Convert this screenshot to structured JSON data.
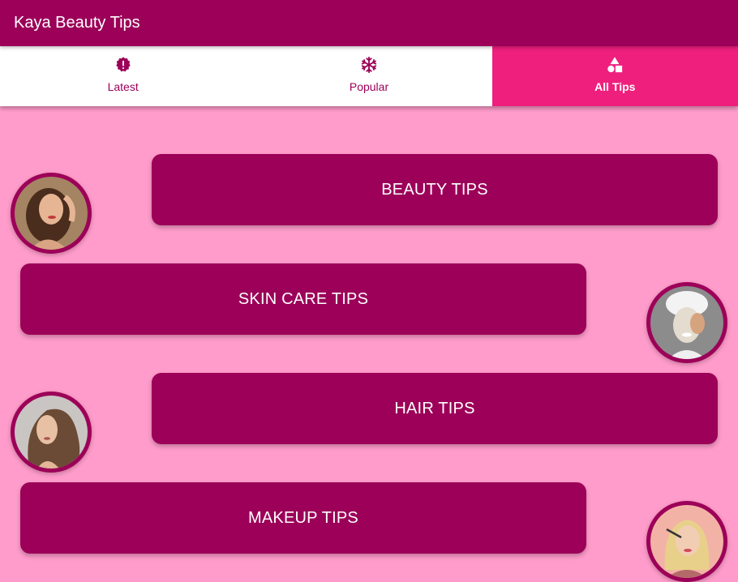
{
  "app": {
    "title": "Kaya Beauty Tips"
  },
  "tabs": [
    {
      "label": "Latest",
      "icon": "alert-badge-icon",
      "active": false
    },
    {
      "label": "Popular",
      "icon": "snowflake-icon",
      "active": false
    },
    {
      "label": "All Tips",
      "icon": "shapes-icon",
      "active": true
    }
  ],
  "categories": [
    {
      "label": "BEAUTY TIPS",
      "avatar": "woman-portrait-wavy-hair"
    },
    {
      "label": "SKIN CARE TIPS",
      "avatar": "woman-face-mask"
    },
    {
      "label": "HAIR TIPS",
      "avatar": "woman-long-hair"
    },
    {
      "label": "MAKEUP TIPS",
      "avatar": "woman-applying-makeup"
    }
  ],
  "colors": {
    "primary": "#9c0058",
    "accent": "#ef1f7d",
    "background": "#ff9ccb"
  }
}
